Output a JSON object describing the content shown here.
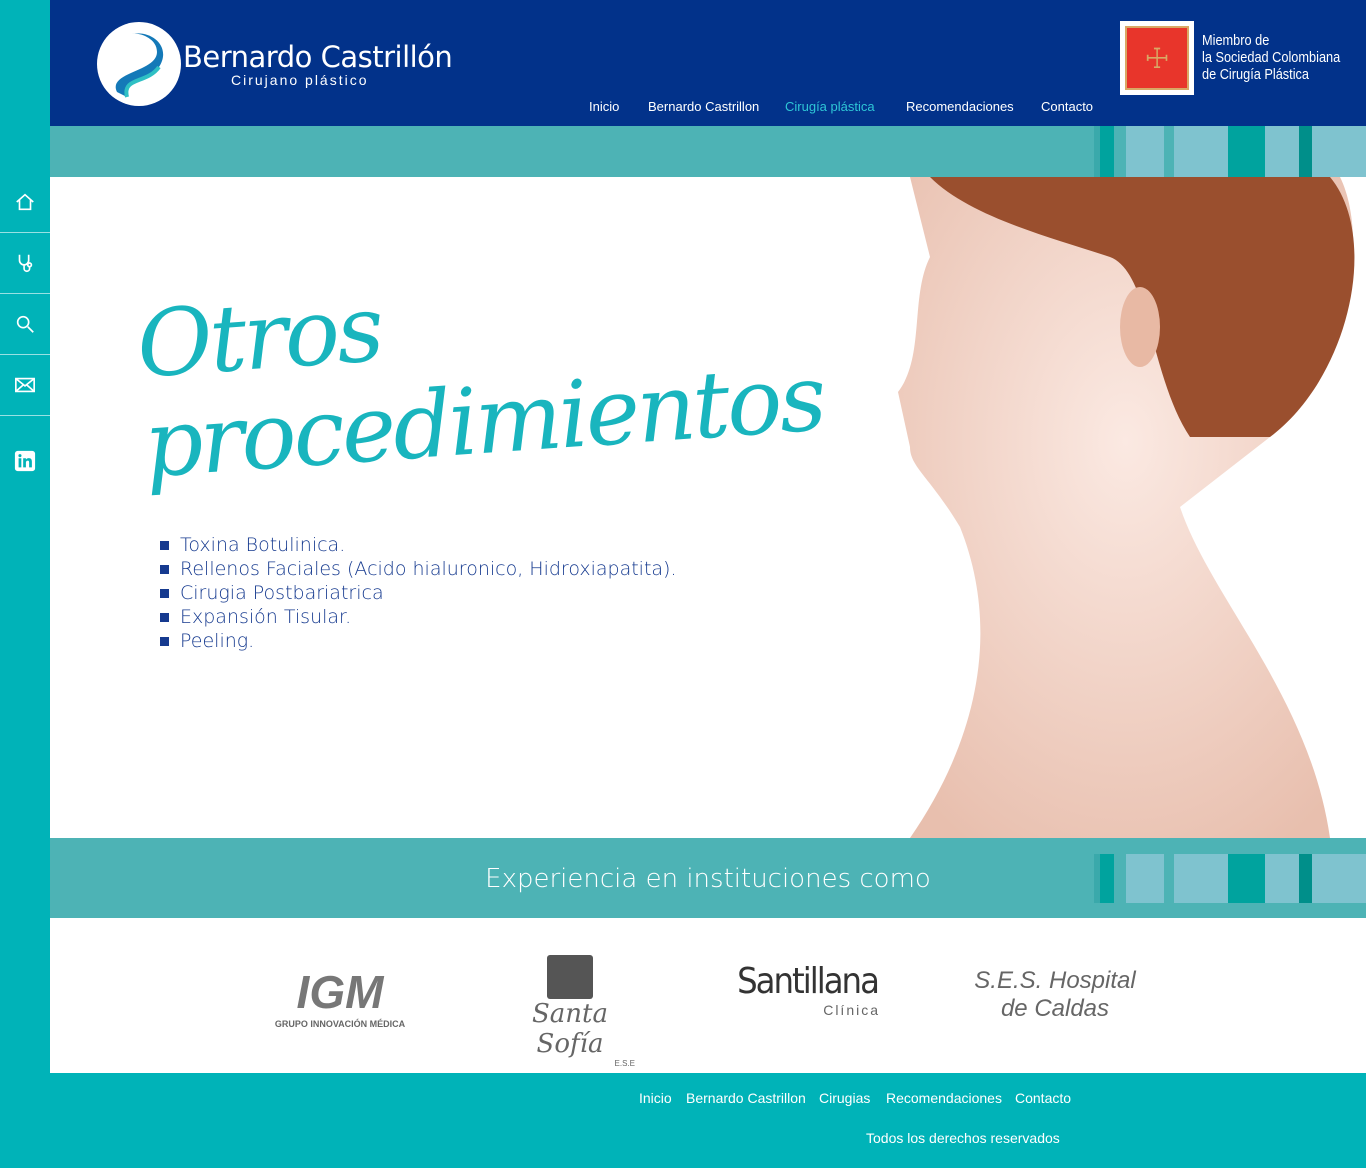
{
  "brand": {
    "name": "Bernardo Castrillón",
    "tagline": "Cirujano plástico"
  },
  "nav": [
    "Inicio",
    "Bernardo Castrillon",
    "Cirugía plástica",
    "Recomendaciones",
    "Contacto"
  ],
  "membership": {
    "line1": "Miembro de",
    "line2": "la Sociedad Colombiana",
    "line3": "de Cirugía Plástica"
  },
  "sidebar": [
    "home-icon",
    "stethoscope-icon",
    "search-icon",
    "mail-icon",
    "linkedin-icon"
  ],
  "hero": {
    "title_line1": "Otros",
    "title_line2": "procedimientos",
    "items": [
      "Toxina Botulinica.",
      "Rellenos Faciales (Acido hialuronico, Hidroxiapatita).",
      "Cirugia Postbariatrica",
      "Expansión Tisular.",
      "Peeling."
    ]
  },
  "experience": {
    "heading": "Experiencia en instituciones como",
    "institutions": [
      {
        "name": "IGM",
        "sub": "GRUPO INNOVACIÓN MÉDICA"
      },
      {
        "name": "Santa Sofía",
        "sub": "E.S.E"
      },
      {
        "name": "Santillana",
        "sub": "Clínica"
      },
      {
        "name": "S.E.S. Hospital de Caldas",
        "sub": ""
      }
    ]
  },
  "footer": {
    "nav": [
      "Inicio",
      "Bernardo Castrillon",
      "Cirugias",
      "Recomendaciones",
      "Contacto"
    ],
    "copyright": "Todos los derechos reservados"
  },
  "colors": {
    "header": "#02328a",
    "teal": "#00b3b8",
    "bar": "#4db3b5",
    "text": "#163a8f"
  }
}
